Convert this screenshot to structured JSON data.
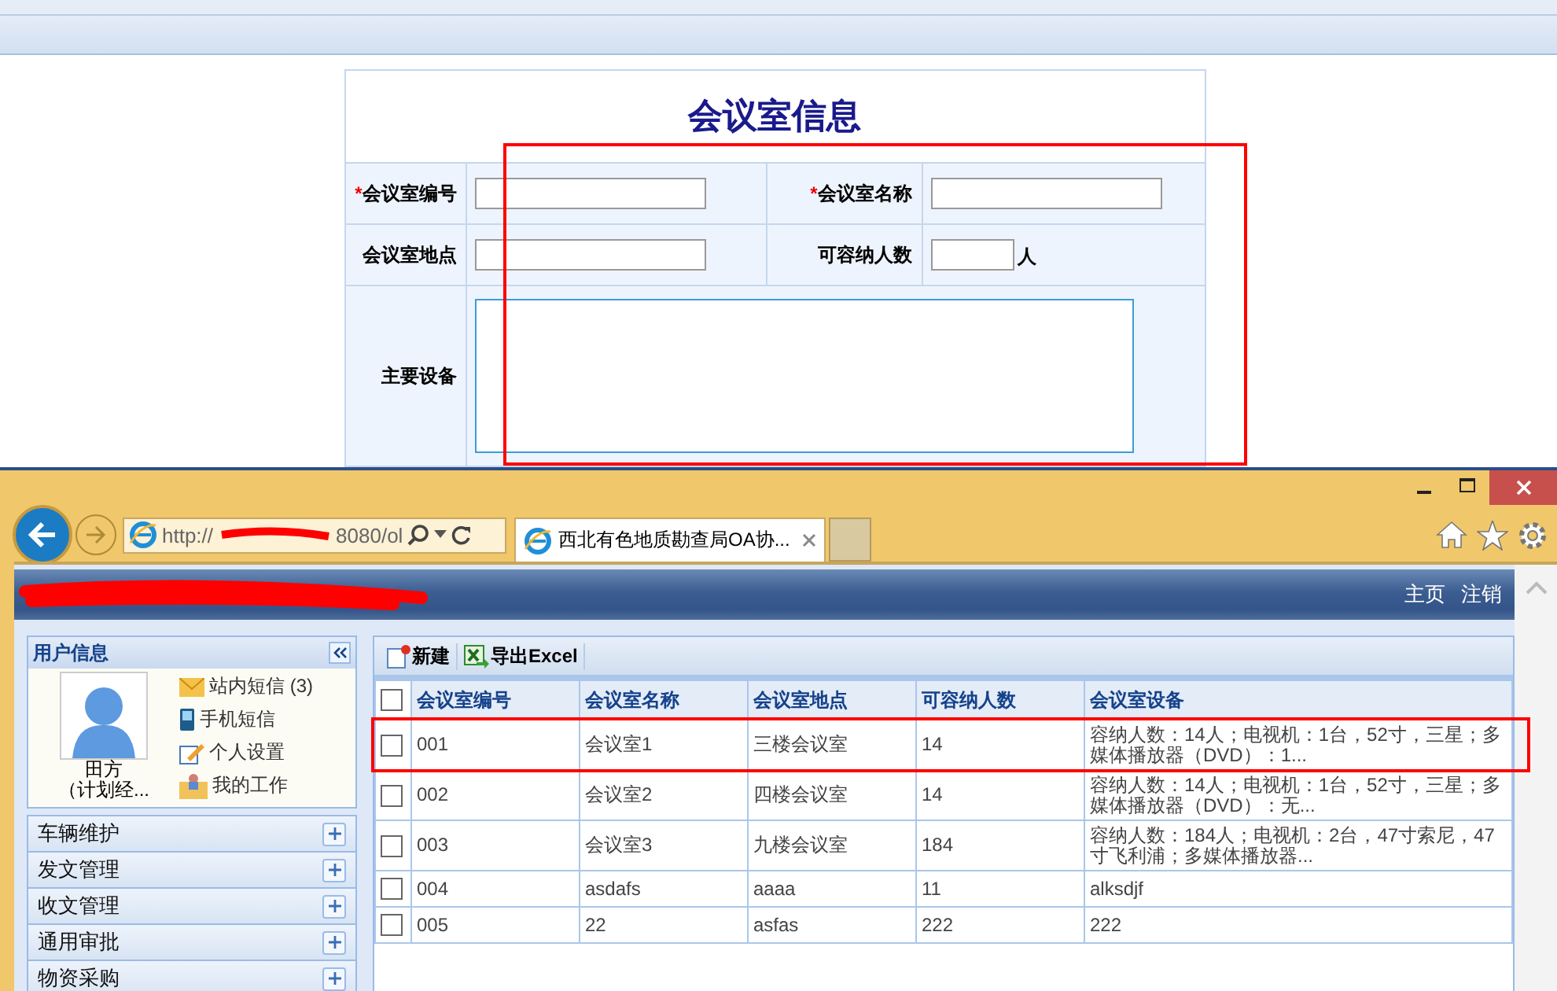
{
  "form": {
    "title": "会议室信息",
    "required_mark": "*",
    "rows": [
      [
        {
          "label": "会议室编号",
          "required": true,
          "kind": "text"
        },
        {
          "label": "会议室名称",
          "required": true,
          "kind": "text"
        }
      ],
      [
        {
          "label": "会议室地点",
          "required": false,
          "kind": "text"
        },
        {
          "label": "可容纳人数",
          "required": false,
          "kind": "number",
          "unit": "人"
        }
      ],
      [
        {
          "label": "主要设备",
          "required": false,
          "kind": "textarea"
        }
      ]
    ]
  },
  "browser": {
    "url_start": "http://",
    "url_end": "8080/ol",
    "tab_title": "西北有色地质勘查局OA协...",
    "header_links": [
      "主页",
      "注销"
    ],
    "sidebar": {
      "title": "用户信息",
      "user_name": "田方",
      "user_role": "（计划经...",
      "links": [
        {
          "kind": "mail",
          "label": "站内短信",
          "count": "(3)"
        },
        {
          "kind": "phone",
          "label": "手机短信"
        },
        {
          "kind": "edit",
          "label": "个人设置"
        },
        {
          "kind": "work",
          "label": "我的工作"
        }
      ],
      "menu": [
        "车辆维护",
        "发文管理",
        "收文管理",
        "通用审批",
        "物资采购"
      ]
    },
    "toolbar": [
      {
        "kind": "new",
        "label": "新建"
      },
      {
        "kind": "excel",
        "label": "导出Excel"
      }
    ],
    "table": {
      "all_checked": false,
      "columns": [
        "会议室编号",
        "会议室名称",
        "会议室地点",
        "可容纳人数",
        "会议室设备"
      ],
      "rows": [
        {
          "checked": false,
          "cells": [
            "001",
            "会议室1",
            "三楼会议室",
            "14",
            "容纳人数：14人；电视机：1台，52寸，三星；多媒体播放器（DVD）：1..."
          ]
        },
        {
          "checked": false,
          "cells": [
            "002",
            "会议室2",
            "四楼会议室",
            "14",
            "容纳人数：14人；电视机：1台，52寸，三星；多媒体播放器（DVD）：无..."
          ]
        },
        {
          "checked": false,
          "cells": [
            "003",
            "会议室3",
            "九楼会议室",
            "184",
            "容纳人数：184人；电视机：2台，47寸索尼，47寸飞利浦；多媒体播放器..."
          ]
        },
        {
          "checked": false,
          "cells": [
            "004",
            "asdafs",
            "aaaa",
            "11",
            "alksdjf"
          ]
        },
        {
          "checked": false,
          "cells": [
            "005",
            "22",
            "asfas",
            "222",
            "222"
          ]
        }
      ]
    }
  }
}
